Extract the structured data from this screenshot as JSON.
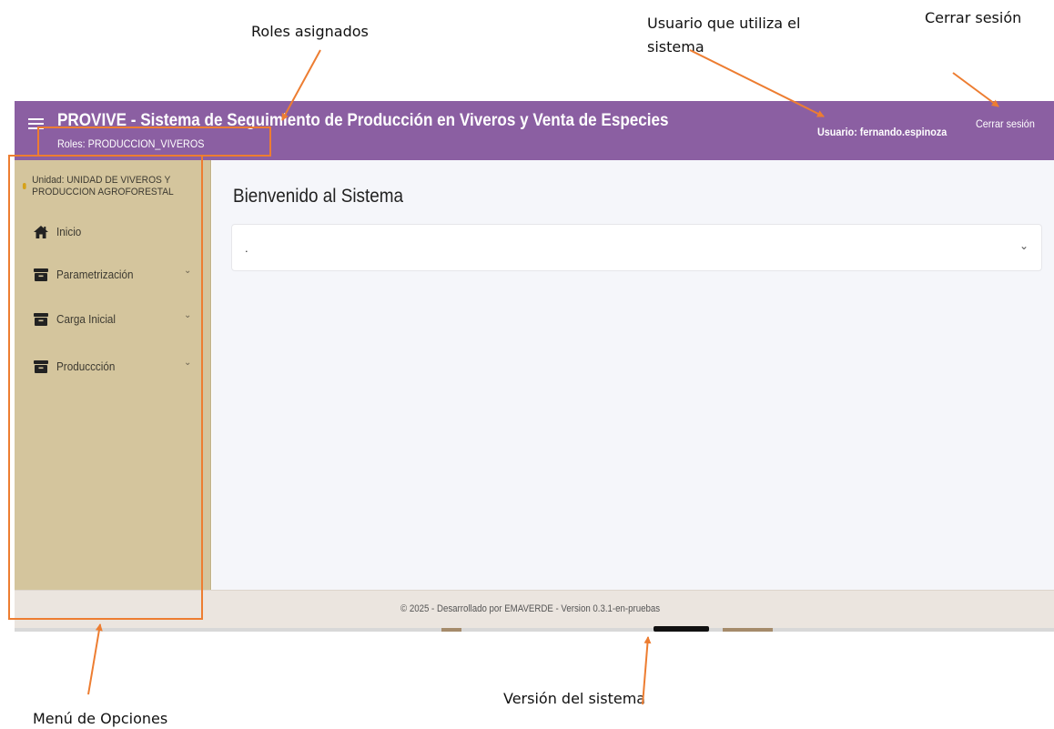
{
  "annotations": {
    "roles": "Roles asignados",
    "user": "Usuario que utiliza el sistema",
    "logout": "Cerrar sesión",
    "menu": "Menú de Opciones",
    "version": "Versión del sistema"
  },
  "header": {
    "title": "PROVIVE - Sistema de Seguimiento de Producción en Viveros y Venta de Especies",
    "roles": "Roles: PRODUCCION_VIVEROS",
    "user": "Usuario: fernando.espinoza",
    "logout": "Cerrar sesión"
  },
  "sidebar": {
    "unit": "Unidad: UNIDAD DE VIVEROS Y PRODUCCION AGROFORESTAL",
    "items": [
      {
        "label": "Inicio",
        "icon": "home-icon",
        "expandable": false
      },
      {
        "label": "Parametrización",
        "icon": "archive-icon",
        "expandable": true
      },
      {
        "label": "Carga Inicial",
        "icon": "archive-icon",
        "expandable": true
      },
      {
        "label": "Produccción",
        "icon": "archive-icon",
        "expandable": true
      }
    ]
  },
  "main": {
    "heading": "Bienvenido al Sistema",
    "accordion_text": "."
  },
  "footer": {
    "text": "© 2025 - Desarrollado por EMAVERDE - Version 0.3.1-en-pruebas"
  },
  "colors": {
    "header": "#8b5fa2",
    "sidebar": "#d4c59d",
    "footer": "#ebe5df",
    "annotation": "#ed7d31"
  }
}
